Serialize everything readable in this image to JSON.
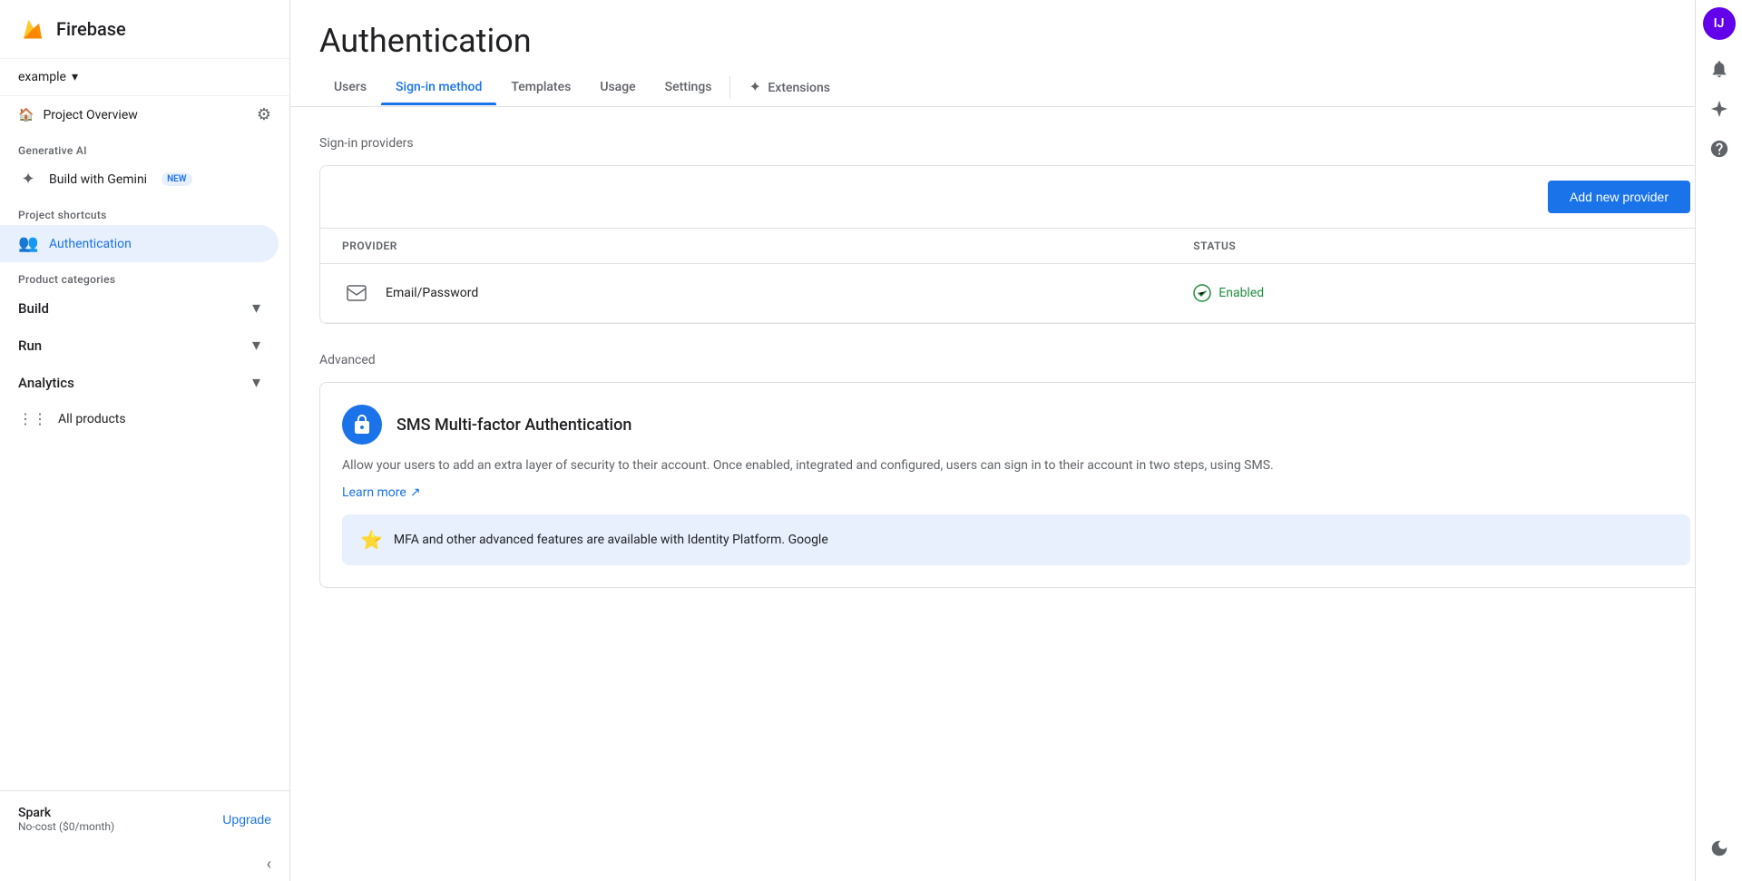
{
  "app": {
    "name": "Firebase"
  },
  "project": {
    "name": "example",
    "dropdown_label": "example"
  },
  "sidebar": {
    "logo": "🔥",
    "project_overview": "Project Overview",
    "settings_icon": "⚙",
    "home_icon": "🏠",
    "sections": {
      "generative_ai_label": "Generative AI",
      "build_with_gemini": "Build with Gemini",
      "new_badge": "NEW",
      "project_shortcuts_label": "Project shortcuts",
      "authentication_item": "Authentication",
      "product_categories_label": "Product categories",
      "build_label": "Build",
      "run_label": "Run",
      "analytics_label": "Analytics",
      "all_products": "All products"
    },
    "footer": {
      "plan_name": "Spark",
      "plan_detail": "No-cost ($0/month)",
      "upgrade_label": "Upgrade"
    }
  },
  "page": {
    "title": "Authentication",
    "tabs": [
      {
        "id": "users",
        "label": "Users"
      },
      {
        "id": "sign-in-method",
        "label": "Sign-in method",
        "active": true
      },
      {
        "id": "templates",
        "label": "Templates"
      },
      {
        "id": "usage",
        "label": "Usage"
      },
      {
        "id": "settings",
        "label": "Settings"
      },
      {
        "id": "extensions",
        "label": "Extensions"
      }
    ]
  },
  "sign_in_providers": {
    "section_label": "Sign-in providers",
    "add_provider_btn": "Add new provider",
    "table": {
      "col_provider": "Provider",
      "col_status": "Status",
      "rows": [
        {
          "provider_name": "Email/Password",
          "provider_icon": "✉",
          "status": "Enabled"
        }
      ]
    }
  },
  "advanced": {
    "section_label": "Advanced",
    "mfa_card": {
      "icon": "🔒",
      "title": "SMS Multi-factor Authentication",
      "description": "Allow your users to add an extra layer of security to their account. Once enabled, integrated and configured, users can sign in to their account in two steps, using SMS.",
      "learn_more_text": "Learn more",
      "learn_more_icon": "↗"
    },
    "banner": {
      "icon": "⭐",
      "text": "MFA and other advanced features are available with Identity Platform. Google"
    }
  },
  "topright": {
    "avatar_initials": "IJ",
    "bell_icon": "🔔",
    "sparkle_icon": "✦",
    "help_icon": "?",
    "moon_icon": "🌙"
  }
}
